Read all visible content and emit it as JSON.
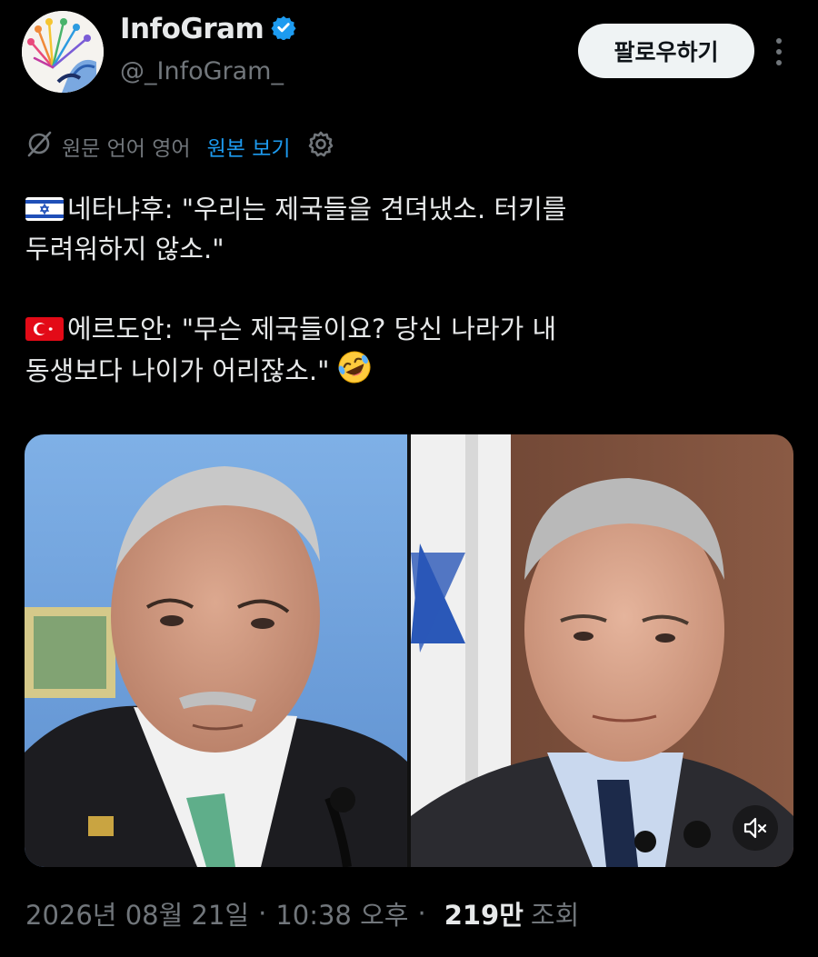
{
  "author": {
    "display_name": "InfoGram",
    "handle": "@_InfoGram_",
    "verified": true,
    "verified_color": "#1d9bf0"
  },
  "follow_button": {
    "label": "팔로우하기"
  },
  "more_icon": "more-vertical-icon",
  "translation": {
    "label": "원문 언어 영어",
    "show_original": "원본 보기",
    "icon": "translate-icon",
    "settings_icon": "gear-icon"
  },
  "tweet": {
    "line1": "네타냐후: \"우리는 제국들을 견뎌냈소. 터키를",
    "line2": "두려워하지 않소.\"",
    "line3": "에르도안: \"무슨 제국들이요? 당신 나라가 내",
    "line4": "동생보다 나이가 어리잖소.\"",
    "flag1": "israel-flag",
    "flag2": "turkey-flag",
    "emoji": "rolling-on-the-floor-laughing"
  },
  "media": {
    "left": "photo-man-left",
    "right": "photo-man-right",
    "mute_icon": "speaker-muted-icon"
  },
  "meta": {
    "date": "2026년 08월 21일",
    "dot": "·",
    "time": "10:38 오후",
    "dot2": "·",
    "views_count": "219만",
    "views_label": "조회"
  },
  "colors": {
    "background": "#000000",
    "text": "#e7e9ea",
    "muted": "#71767b",
    "link": "#1d9bf0"
  }
}
